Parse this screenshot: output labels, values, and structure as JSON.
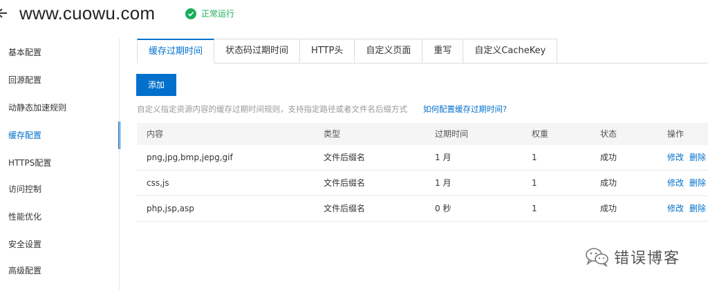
{
  "header": {
    "domain": "www.cuowu.com",
    "status": "正常运行"
  },
  "sidebar": {
    "items": [
      {
        "label": "基本配置"
      },
      {
        "label": "回源配置"
      },
      {
        "label": "动静态加速规则"
      },
      {
        "label": "缓存配置",
        "active": true
      },
      {
        "label": "HTTPS配置"
      },
      {
        "label": "访问控制"
      },
      {
        "label": "性能优化"
      },
      {
        "label": "安全设置"
      },
      {
        "label": "高级配置"
      }
    ]
  },
  "tabs": [
    {
      "label": "缓存过期时间",
      "active": true
    },
    {
      "label": "状态码过期时间"
    },
    {
      "label": "HTTP头"
    },
    {
      "label": "自定义页面"
    },
    {
      "label": "重写"
    },
    {
      "label": "自定义CacheKey"
    }
  ],
  "toolbar": {
    "add_label": "添加"
  },
  "hint": {
    "text": "自定义指定资源内容的缓存过期时间规则，支持指定路径或者文件名后缀方式",
    "link": "如何配置缓存过期时间?"
  },
  "table": {
    "columns": [
      "内容",
      "类型",
      "过期时间",
      "权重",
      "状态",
      "操作"
    ],
    "rows": [
      {
        "content": "png,jpg,bmp,jepg,gif",
        "type": "文件后缀名",
        "expire": "1 月",
        "weight": "1",
        "status": "成功"
      },
      {
        "content": "css,js",
        "type": "文件后缀名",
        "expire": "1 月",
        "weight": "1",
        "status": "成功"
      },
      {
        "content": "php,jsp,asp",
        "type": "文件后缀名",
        "expire": "0 秒",
        "weight": "1",
        "status": "成功"
      }
    ],
    "actions": {
      "edit": "修改",
      "delete": "删除"
    }
  },
  "watermark": {
    "text": "错误博客",
    "icon": "wechat-icon"
  },
  "colors": {
    "accent": "#0070cc",
    "status_green": "#1aad5a"
  }
}
